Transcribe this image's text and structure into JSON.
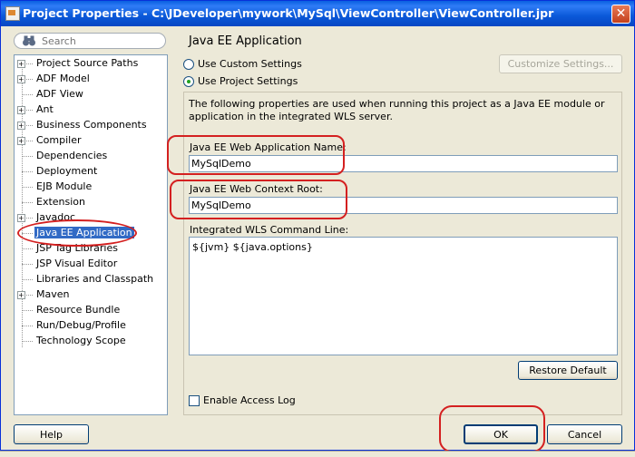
{
  "window": {
    "title": "Project Properties - C:\\JDeveloper\\mywork\\MySql\\ViewController\\ViewController.jpr",
    "close_glyph": "✕"
  },
  "search": {
    "placeholder": "Search",
    "icon": "binoculars-icon"
  },
  "tree": {
    "items": [
      {
        "label": "Project Source Paths",
        "expandable": true
      },
      {
        "label": "ADF Model",
        "expandable": true
      },
      {
        "label": "ADF View",
        "expandable": false
      },
      {
        "label": "Ant",
        "expandable": true
      },
      {
        "label": "Business Components",
        "expandable": true
      },
      {
        "label": "Compiler",
        "expandable": true
      },
      {
        "label": "Dependencies",
        "expandable": false
      },
      {
        "label": "Deployment",
        "expandable": false
      },
      {
        "label": "EJB Module",
        "expandable": false
      },
      {
        "label": "Extension",
        "expandable": false
      },
      {
        "label": "Javadoc",
        "expandable": true
      },
      {
        "label": "Java EE Application",
        "expandable": false,
        "selected": true
      },
      {
        "label": "JSP Tag Libraries",
        "expandable": false
      },
      {
        "label": "JSP Visual Editor",
        "expandable": false
      },
      {
        "label": "Libraries and Classpath",
        "expandable": false
      },
      {
        "label": "Maven",
        "expandable": true
      },
      {
        "label": "Resource Bundle",
        "expandable": false
      },
      {
        "label": "Run/Debug/Profile",
        "expandable": false
      },
      {
        "label": "Technology Scope",
        "expandable": false
      }
    ]
  },
  "panel": {
    "title": "Java EE Application",
    "use_custom_settings": "Use Custom Settings",
    "use_project_settings": "Use Project Settings",
    "customize_settings_button": "Customize Settings...",
    "description": "The following properties are used when running this project as a Java EE module or application in the integrated WLS server.",
    "web_app_name_label": "Java EE Web Application Name:",
    "web_app_name_value": "MySqlDemo",
    "context_root_label": "Java EE Web Context Root:",
    "context_root_value": "MySqlDemo",
    "wls_command_label": "Integrated WLS Command Line:",
    "wls_command_value": "${jvm} ${java.options}",
    "restore_default_button": "Restore Default",
    "enable_access_log": "Enable Access Log"
  },
  "footer": {
    "help_button": "Help",
    "ok_button": "OK",
    "cancel_button": "Cancel"
  },
  "colors": {
    "titlebar": "#0a58d8",
    "selection": "#316ac5",
    "annotation": "#d42020",
    "dialog_bg": "#ece9d8"
  }
}
